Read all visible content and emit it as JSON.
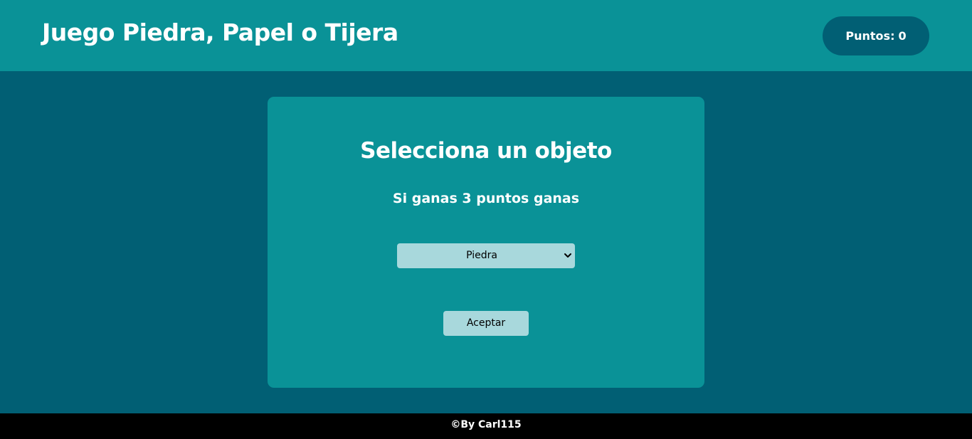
{
  "header": {
    "title": "Juego Piedra, Papel o Tijera",
    "score_label": "Puntos:",
    "score_value": "0"
  },
  "card": {
    "title": "Selecciona un objeto",
    "subtitle": "Si ganas 3 puntos ganas",
    "select": {
      "selected": "Piedra",
      "icon": "chevron-down-icon"
    },
    "accept_label": "Aceptar"
  },
  "footer": {
    "text": "©By Carl115"
  },
  "colors": {
    "header_bg": "#0a9297",
    "page_bg": "#015f74",
    "card_bg": "#0a9297",
    "control_bg": "#a8d8dc",
    "footer_bg": "#000000"
  }
}
